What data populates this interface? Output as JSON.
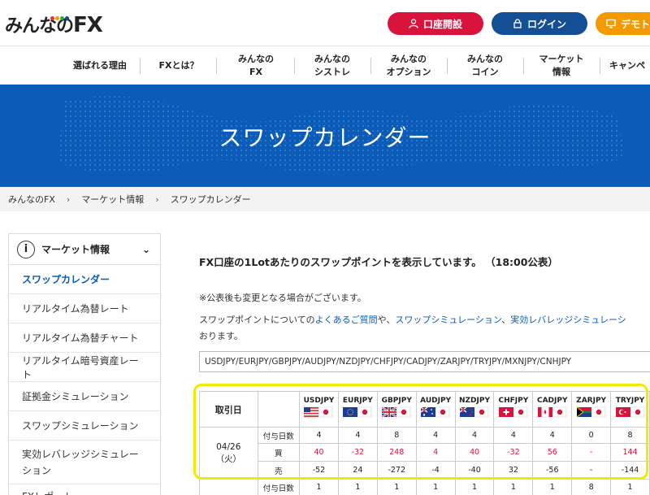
{
  "header": {
    "logo": "みんなの",
    "logo_fx": "FX",
    "btn_open": "口座開設",
    "btn_login": "ログイン",
    "btn_demo": "デモト",
    "brand_colors": {
      "red": "#d9143c",
      "blue": "#144e95",
      "orange": "#f29a00"
    }
  },
  "nav": [
    "選ばれる理由",
    "FXとは？",
    "みんなの\nFX",
    "みんなの\nシストレ",
    "みんなの\nオプション",
    "みんなの\nコイン",
    "マーケット\n情報",
    "キャンペ"
  ],
  "hero": {
    "title": "スワップカレンダー"
  },
  "breadcrumb": [
    "みんなのFX",
    "マーケット情報",
    "スワップカレンダー"
  ],
  "sidebar": {
    "heading": "マーケット情報",
    "items": [
      "スワップカレンダー",
      "リアルタイム為替レート",
      "リアルタイム為替チャート",
      "リアルタイム暗号資産レート",
      "証拠金シミュレーション",
      "スワップシミュレーション",
      "実効レバレッジシミュレーション",
      "FXレポート"
    ]
  },
  "content": {
    "lead": "FX口座の1Lotあたりのスワップポイントを表示しています。 （18:00公表）",
    "note": "※公表後も変更となる場合がございます。",
    "para_1": "スワップポイントについての",
    "link_faq": "よくあるご質問",
    "para_2": "や、",
    "link_swap_sim": "スワップシミュレーション",
    "para_3": "、",
    "link_lev_sim": "実効レバレッジシミュレーシ",
    "para_4": "おります。",
    "pairs": "USDJPY/EURJPY/GBPJPY/AUDJPY/NZDJPY/CHFJPY/CADJPY/ZARJPY/TRYJPY/MXNJPY/CNHJPY"
  },
  "table": {
    "header_label": "取引日",
    "currencies": [
      "USDJPY",
      "EURJPY",
      "GBPJPY",
      "AUDJPY",
      "NZDJPY",
      "CHFJPY",
      "CADJPY",
      "ZARJPY",
      "TRYJPY"
    ],
    "row_labels": {
      "days": "付与日数",
      "buy": "買",
      "sell": "売"
    },
    "rows": [
      {
        "date": "04/26",
        "weekday": "（火）",
        "days": [
          "4",
          "4",
          "8",
          "4",
          "4",
          "4",
          "4",
          "0",
          "8"
        ],
        "buy": [
          "40",
          "-32",
          "248",
          "4",
          "40",
          "-32",
          "56",
          "-",
          "144"
        ],
        "sell": [
          "-52",
          "24",
          "-272",
          "-4",
          "-40",
          "32",
          "-56",
          "-",
          "-144"
        ]
      },
      {
        "date": "",
        "weekday": "",
        "days": [
          "1",
          "1",
          "1",
          "1",
          "1",
          "1",
          "1",
          "8",
          "1"
        ]
      }
    ]
  }
}
